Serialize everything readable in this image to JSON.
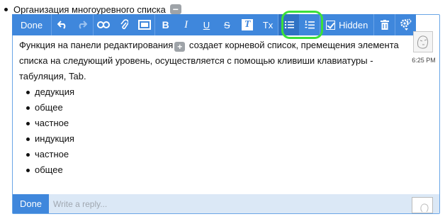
{
  "top_item": {
    "text": "Организация многоуревного списка",
    "collapse_symbol": "−"
  },
  "toolbar": {
    "done_label": "Done",
    "hidden_label": "Hidden",
    "hidden_checked": true,
    "clear_format_label": "Tx",
    "buttons": [
      "undo-icon",
      "redo-icon",
      "link-icon",
      "attachment-icon",
      "image-icon",
      "bold",
      "italic",
      "underline",
      "strikethrough",
      "text-style",
      "clear-formatting",
      "bullet-list-icon",
      "numbered-list-icon",
      "hidden-checkbox",
      "trash-icon",
      "settings-icon"
    ],
    "accent_color": "#3f87dc",
    "highlight_color": "#3ce03a",
    "bold_label": "B",
    "italic_label": "I",
    "underline_label": "U",
    "strike_label": "S",
    "textstyle_label": "T"
  },
  "content": {
    "paragraph_part1": "Функция на панели редактирования",
    "inline_comment_symbol": "+",
    "paragraph_part2": " создает корневой список, премещения элемента списка на следующий уровень, осуществляется с помощью кливиши клавиатуры - табуляция, Tab.",
    "list": [
      "дедукция",
      "общее",
      "частное",
      "индукция",
      "частное",
      "общее"
    ]
  },
  "timestamp": "6:25 PM",
  "reply": {
    "done_label": "Done",
    "placeholder": "Write a reply..."
  }
}
